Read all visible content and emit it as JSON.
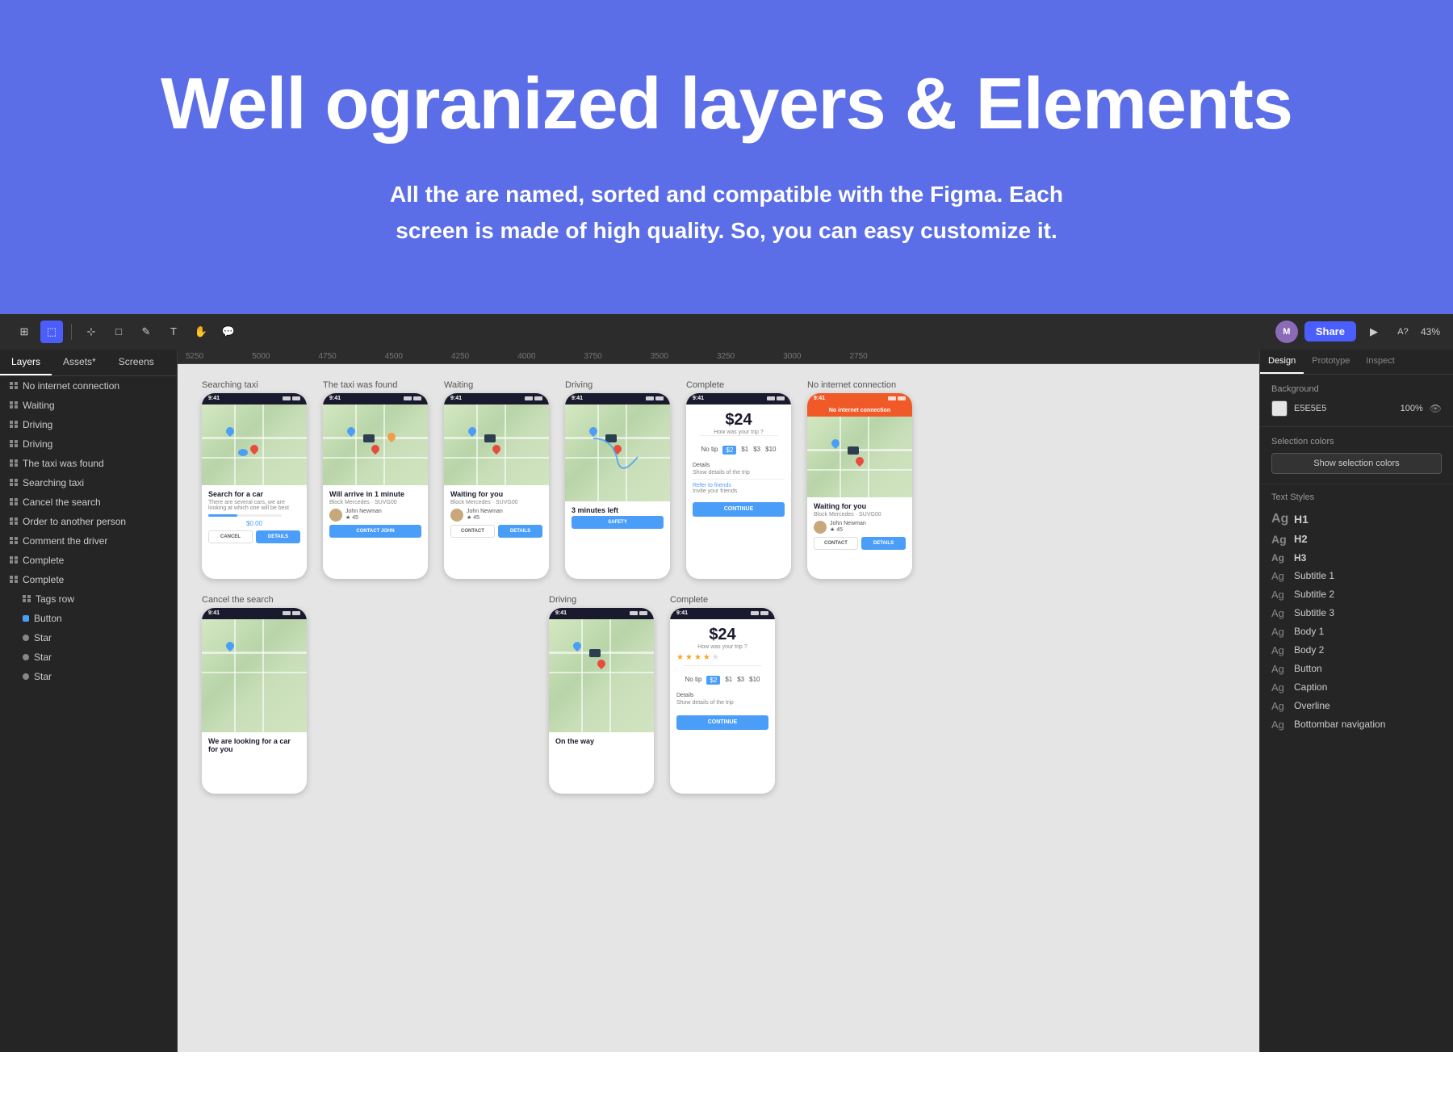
{
  "hero": {
    "title": "Well ogranized layers & Elements",
    "subtitle": "All the are named, sorted and compatible with the Figma. Each screen is made of high quality. So, you can easy customize it.",
    "bg_color": "#5B6EE8"
  },
  "toolbar": {
    "share_label": "Share",
    "zoom": "43%",
    "play_icon": "▶",
    "cursor_icon": "A?",
    "avatar_initials": "M"
  },
  "left_panel": {
    "tabs": [
      "Layers",
      "Assets*",
      "Screens"
    ],
    "layers": [
      {
        "label": "No internet connection",
        "level": 0
      },
      {
        "label": "Waiting",
        "level": 0
      },
      {
        "label": "Driving",
        "level": 0
      },
      {
        "label": "Driving",
        "level": 0
      },
      {
        "label": "The taxi was found",
        "level": 0
      },
      {
        "label": "Searching taxi",
        "level": 0
      },
      {
        "label": "Cancel the search",
        "level": 0
      },
      {
        "label": "Order to another person",
        "level": 0
      },
      {
        "label": "Comment the driver",
        "level": 0
      },
      {
        "label": "Complete",
        "level": 0
      },
      {
        "label": "Complete",
        "level": 0
      },
      {
        "label": "Tags row",
        "level": 1
      },
      {
        "label": "Button",
        "level": 1,
        "dot": "blue"
      },
      {
        "label": "Star",
        "level": 1,
        "dot": "orange"
      },
      {
        "label": "Star",
        "level": 1,
        "dot": "orange"
      },
      {
        "label": "Star",
        "level": 1,
        "dot": "orange"
      }
    ]
  },
  "right_panel": {
    "tabs": [
      "Design",
      "Prototype",
      "Inspect"
    ],
    "background_section": {
      "title": "Background",
      "swatch_value": "E5E5E5",
      "opacity": "100%"
    },
    "selection_colors_section": {
      "title": "Selection colors",
      "show_btn": "Show selection colors"
    },
    "text_styles_section": {
      "title": "Text Styles",
      "styles": [
        {
          "ag": "Ag",
          "label": "H1",
          "size": "h1"
        },
        {
          "ag": "Ag",
          "label": "H2",
          "size": "h2"
        },
        {
          "ag": "Ag",
          "label": "H3",
          "size": "h3"
        },
        {
          "ag": "Ag",
          "label": "Subtitle 1",
          "size": "normal"
        },
        {
          "ag": "Ag",
          "label": "Subtitle 2",
          "size": "normal"
        },
        {
          "ag": "Ag",
          "label": "Subtitle 3",
          "size": "normal"
        },
        {
          "ag": "Ag",
          "label": "Body 1",
          "size": "normal"
        },
        {
          "ag": "Ag",
          "label": "Body 2",
          "size": "normal"
        },
        {
          "ag": "Ag",
          "label": "Button",
          "size": "normal"
        },
        {
          "ag": "Ag",
          "label": "Caption",
          "size": "normal"
        },
        {
          "ag": "Ag",
          "label": "Overline",
          "size": "normal"
        },
        {
          "ag": "Ag",
          "label": "Bottombar navigation",
          "size": "normal"
        }
      ]
    }
  },
  "screens_row1": [
    {
      "label": "Searching taxi",
      "type": "search"
    },
    {
      "label": "The taxi was found",
      "type": "found"
    },
    {
      "label": "Waiting",
      "type": "waiting"
    },
    {
      "label": "Driving",
      "type": "driving"
    },
    {
      "label": "Complete",
      "type": "complete"
    },
    {
      "label": "No internet connection",
      "type": "nointernet"
    }
  ],
  "screens_row2": [
    {
      "label": "Cancel the search",
      "type": "cancel"
    },
    {
      "label": "Driving",
      "type": "driving2"
    },
    {
      "label": "Complete",
      "type": "complete2"
    }
  ],
  "phone_content": {
    "search": {
      "title": "Search for a car",
      "sub": "There are several cars, we are looking at which one will be best",
      "progress": true,
      "btns": [
        "CANCEL",
        "DETAILS"
      ]
    },
    "found": {
      "title": "Will arrive in 1 minute",
      "driver": "Block Mercedes · SUVG00",
      "btns": [
        "CONTACT JOHN"
      ]
    },
    "waiting": {
      "title": "Waiting for you",
      "driver": "Block Mercedes · SUVG00",
      "btns": [
        "CONTACT",
        "DETAILS"
      ]
    },
    "driving": {
      "title": "3 minutes left",
      "btns": [
        "SAFETY"
      ]
    },
    "complete": {
      "price": "$24",
      "question": "How was your trip ?",
      "details": "Details",
      "refer": "Refer to friends",
      "btns": [
        "CONTINUE"
      ]
    },
    "nointernet": {
      "title": "Waiting for you",
      "driver": "Block Mercedes · SUVG00",
      "banner": "No internet connection",
      "btns": [
        "CONTACT",
        "DETAILS"
      ]
    }
  },
  "ruler_marks": [
    "5250",
    "5000",
    "4750",
    "4500",
    "4250",
    "4000",
    "3750",
    "3500",
    "3250",
    "3000",
    "2750"
  ]
}
